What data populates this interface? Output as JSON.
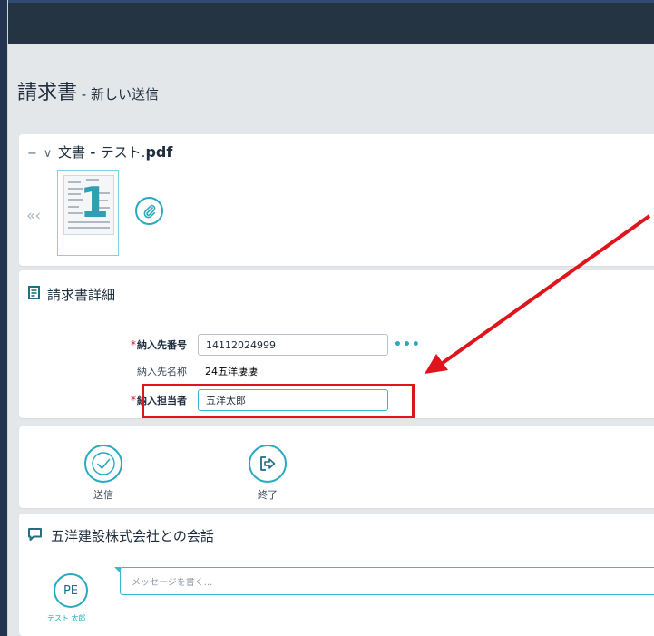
{
  "page": {
    "title": "請求書",
    "subtitle": " - 新しい送信"
  },
  "document": {
    "collapse_icon": "−",
    "expand_icon": "∨",
    "title_prefix": "文書",
    "separator": " - ",
    "file_base": "テスト.",
    "file_ext": "pdf",
    "prev_icon": "«‹",
    "attach_icon": "paperclip-icon"
  },
  "invoice_details": {
    "title": "請求書詳細",
    "icon": "document-list-icon",
    "fields": {
      "destination_number": {
        "label": "納入先番号",
        "value": "14112024999",
        "required": "*",
        "more": "•••"
      },
      "destination_name": {
        "label": "納入先名称",
        "value": "24五洋凄凄"
      },
      "person_in_charge": {
        "label": "納入担当者",
        "value": "五洋太郎",
        "required": "*"
      }
    }
  },
  "actions": {
    "send": {
      "label": "送信",
      "icon": "check-circle-icon"
    },
    "exit": {
      "label": "終了",
      "icon": "exit-icon"
    }
  },
  "conversation": {
    "title": "五洋建設株式会社との会話",
    "icon": "chat-bubble-icon",
    "avatar_initials": "PE",
    "avatar_name": "テスト 太郎",
    "placeholder": "メッセージを書く..."
  },
  "annotation": {
    "highlight_color": "#e0141b"
  }
}
